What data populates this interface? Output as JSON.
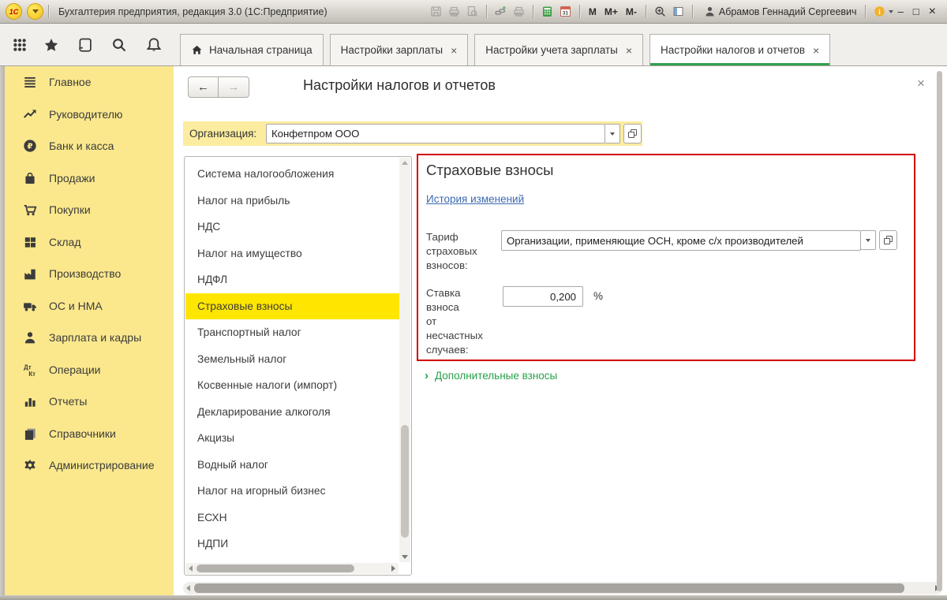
{
  "colors": {
    "sidebar_bg": "#fbe88d",
    "selection_yellow": "#ffe600",
    "org_row_bg": "#fcec9f",
    "active_tab_underline": "#2fa24c",
    "red_outline": "#d10000",
    "link_blue": "#3c69b0",
    "link_green": "#28a04a"
  },
  "titlebar": {
    "logo_text": "1С",
    "title": "Бухгалтерия предприятия, редакция 3.0  (1С:Предприятие)",
    "memory_m": "M",
    "memory_m_plus": "M+",
    "memory_m_minus": "M-",
    "user_name": "Абрамов Геннадий Сергеевич",
    "minimize": "–",
    "maximize": "□",
    "close": "×"
  },
  "tabbar": {
    "tabs": [
      {
        "label": "Начальная страница",
        "close": ""
      },
      {
        "label": "Настройки зарплаты",
        "close": "×"
      },
      {
        "label": "Настройки учета зарплаты",
        "close": "×"
      },
      {
        "label": "Настройки налогов и отчетов",
        "close": "×"
      }
    ]
  },
  "sidebar": {
    "items": [
      {
        "icon": "menu-icon",
        "label": "Главное"
      },
      {
        "icon": "trend-icon",
        "label": "Руководителю"
      },
      {
        "icon": "ruble-icon",
        "label": "Банк и касса"
      },
      {
        "icon": "bag-icon",
        "label": "Продажи"
      },
      {
        "icon": "cart-icon",
        "label": "Покупки"
      },
      {
        "icon": "boxes-icon",
        "label": "Склад"
      },
      {
        "icon": "factory-icon",
        "label": "Производство"
      },
      {
        "icon": "truck-icon",
        "label": "ОС и НМА"
      },
      {
        "icon": "person-icon",
        "label": "Зарплата и кадры"
      },
      {
        "icon": "dtkt-icon",
        "label": "Операции"
      },
      {
        "icon": "barchart-icon",
        "label": "Отчеты"
      },
      {
        "icon": "books-icon",
        "label": "Справочники"
      },
      {
        "icon": "gear-icon",
        "label": "Администрирование"
      }
    ]
  },
  "content": {
    "back": "←",
    "forward": "→",
    "close": "×",
    "page_title": "Настройки налогов и отчетов",
    "organization": {
      "label": "Организация:",
      "value": "Конфетпром ООО"
    },
    "sections": [
      "Система налогообложения",
      "Налог на прибыль",
      "НДС",
      "Налог на имущество",
      "НДФЛ",
      "Страховые взносы",
      "Транспортный налог",
      "Земельный налог",
      "Косвенные налоги (импорт)",
      "Декларирование алкоголя",
      "Акцизы",
      "Водный налог",
      "Налог на игорный бизнес",
      "ЕСХН",
      "НДПИ"
    ],
    "selected_section": "Страховые взносы",
    "details": {
      "heading": "Страховые взносы",
      "history_link": "История изменений",
      "tariff_label": "Тариф\nстраховых\nвзносов:",
      "tariff_value": "Организации, применяющие ОСН, кроме с/х производителей",
      "rate_label": "Ставка\nвзноса\nот\nнесчастных\nслучаев:",
      "rate_value": "0,200",
      "rate_unit": "%",
      "additional_chevron": "›",
      "additional_link": "Дополнительные взносы"
    }
  }
}
